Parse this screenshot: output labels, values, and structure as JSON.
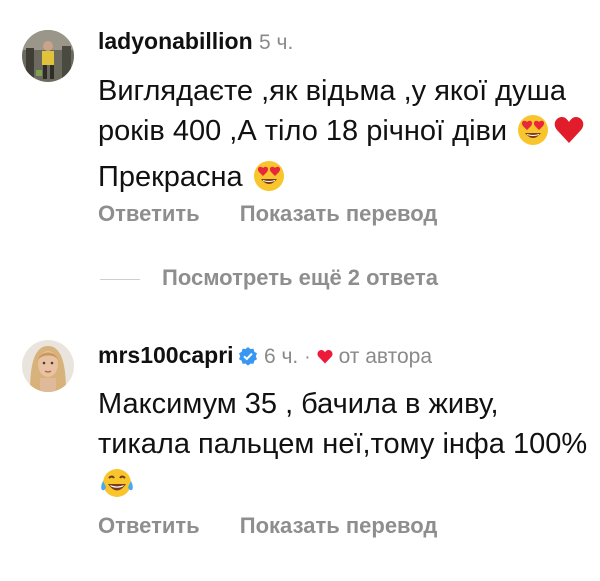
{
  "comments": [
    {
      "username": "ladyonabillion",
      "time": "5 ч.",
      "text_parts": [
        "Виглядаєте ,як відьма ,у якої душа років 400 ,А тіло 18 річної діви",
        "Прекрасна"
      ],
      "emojis": [
        "heart-eyes-emoji",
        "red-heart-emoji",
        "heart-eyes-emoji"
      ],
      "reply_label": "Ответить",
      "translate_label": "Показать перевод"
    },
    {
      "username": "mrs100capri",
      "verified": true,
      "time": "6 ч.",
      "separator": "·",
      "liked_by_author": "от автора",
      "text": "Максимум 35 , бачила в живу, тикала пальцем неї,тому інфа 100%",
      "emojis": [
        "tears-of-joy-emoji"
      ],
      "reply_label": "Ответить",
      "translate_label": "Показать перевод"
    }
  ],
  "view_more_replies": "Посмотреть ещё 2 ответа",
  "colors": {
    "muted": "#8e8e8e",
    "verified": "#3897f0",
    "heart": "#ed1b3a"
  }
}
